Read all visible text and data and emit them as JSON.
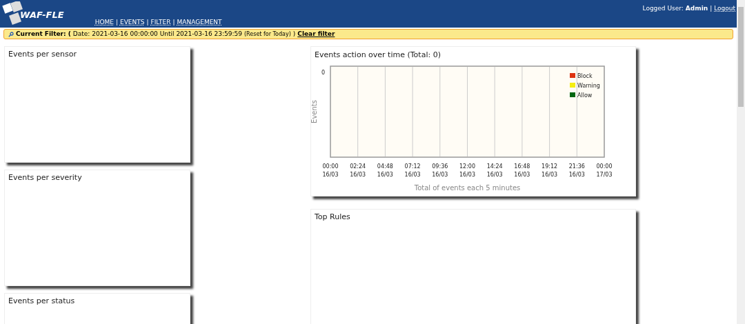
{
  "header": {
    "logo_text": "WAF-FLE",
    "nav": [
      "HOME",
      "EVENTS",
      "FILTER",
      "MANAGEMENT"
    ],
    "separator": "|",
    "user_label": "Logged User:",
    "user_name": "Admin",
    "logout": "Logout"
  },
  "filter": {
    "label": "Current Filter: (",
    "text": "Date:  2021-03-16 00:00:00 Until 2021-03-16 23:59:59",
    "reset": "(Reset for Today)",
    "close": ")",
    "clear": "Clear filter"
  },
  "left_panels": [
    {
      "title": "Events per sensor"
    },
    {
      "title": "Events per severity"
    },
    {
      "title": "Events per status"
    }
  ],
  "chart_panel": {
    "title": "Events action over time (Total: 0)",
    "y_tick_label": "0",
    "y_axis_label": "Events",
    "x_axis_label": "Total of events each 5 minutes",
    "x_labels": [
      {
        "time": "00:00",
        "date": "16/03"
      },
      {
        "time": "02:24",
        "date": "16/03"
      },
      {
        "time": "04:48",
        "date": "16/03"
      },
      {
        "time": "07:12",
        "date": "16/03"
      },
      {
        "time": "09:36",
        "date": "16/03"
      },
      {
        "time": "12:00",
        "date": "16/03"
      },
      {
        "time": "14:24",
        "date": "16/03"
      },
      {
        "time": "16:48",
        "date": "16/03"
      },
      {
        "time": "19:12",
        "date": "16/03"
      },
      {
        "time": "21:36",
        "date": "16/03"
      },
      {
        "time": "00:00",
        "date": "17/03"
      }
    ],
    "legend": [
      {
        "name": "Block",
        "color": "#dd3311"
      },
      {
        "name": "Warning",
        "color": "#f5ee11"
      },
      {
        "name": "Allow",
        "color": "#006611"
      }
    ]
  },
  "top_rules": {
    "title": "Top Rules"
  }
}
